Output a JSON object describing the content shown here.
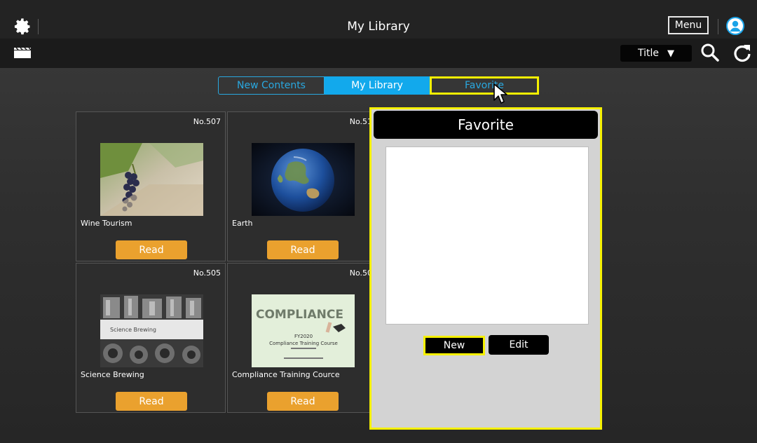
{
  "header": {
    "title": "My Library",
    "menu_label": "Menu",
    "settings_icon": "gear-icon",
    "user_icon": "user-avatar-icon"
  },
  "toolbar": {
    "media_icon": "clapperboard-icon",
    "sort_label": "Title",
    "sort_icon": "triangle-down-icon",
    "search_icon": "search-icon",
    "refresh_icon": "refresh-icon"
  },
  "tabs": [
    {
      "label": "New Contents",
      "active": false
    },
    {
      "label": "My Library",
      "active": true
    },
    {
      "label": "Favorite",
      "active": false,
      "highlighted": true
    }
  ],
  "cards": [
    {
      "no": "No.507",
      "name": "Wine Tourism",
      "button": "Read"
    },
    {
      "no": "No.51",
      "name": "Earth",
      "button": "Read"
    },
    {
      "no": "No.505",
      "name": "Science Brewing",
      "button": "Read",
      "thumb_caption": "Science Brewing"
    },
    {
      "no": "No.50",
      "name": "Compliance Training Cource",
      "button": "Read",
      "thumb_title": "COMPLIANCE",
      "thumb_line1": "FY2020",
      "thumb_line2": "Compliance Training Course"
    }
  ],
  "favorite_panel": {
    "title": "Favorite",
    "new_label": "New",
    "edit_label": "Edit"
  },
  "colors": {
    "accent_blue": "#12a9ec",
    "highlight_yellow": "#f5f000",
    "read_button": "#eaa12e"
  }
}
